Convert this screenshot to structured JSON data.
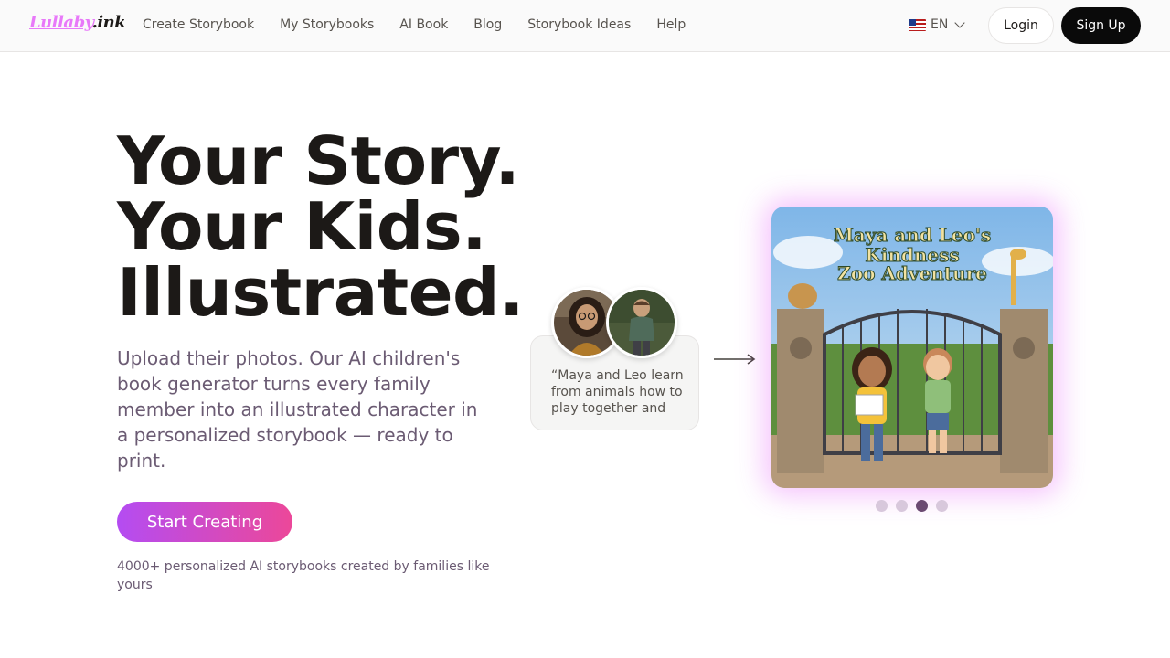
{
  "header": {
    "logo": {
      "part1": "Lullaby",
      "part2": ".ink"
    },
    "nav": [
      {
        "label": "Create Storybook"
      },
      {
        "label": "My Storybooks"
      },
      {
        "label": "AI Book"
      },
      {
        "label": "Blog"
      },
      {
        "label": "Storybook Ideas"
      },
      {
        "label": "Help"
      }
    ],
    "language": {
      "code": "EN",
      "icon": "us-flag-icon"
    },
    "login_label": "Login",
    "signup_label": "Sign Up"
  },
  "hero": {
    "title_lines": [
      "Your Story.",
      "Your Kids.",
      "Illustrated."
    ],
    "subtitle": "Upload their photos. Our AI children's book generator turns every family member into an illustrated character in a personalized storybook — ready to print.",
    "cta_label": "Start Creating",
    "note": "4000+ personalized AI storybooks created by families like yours"
  },
  "showcase": {
    "prompt": "“Maya and Leo learn from animals how to play together and be…",
    "cover_title_lines": [
      "Maya and Leo's",
      "Kindness",
      "Zoo Adventure"
    ],
    "slides": 4,
    "active_slide": 3
  },
  "colors": {
    "brand_pink": "#e879f9",
    "cta_start": "#b44cf2",
    "cta_end": "#ec4899",
    "text_muted": "#6b5b73"
  }
}
